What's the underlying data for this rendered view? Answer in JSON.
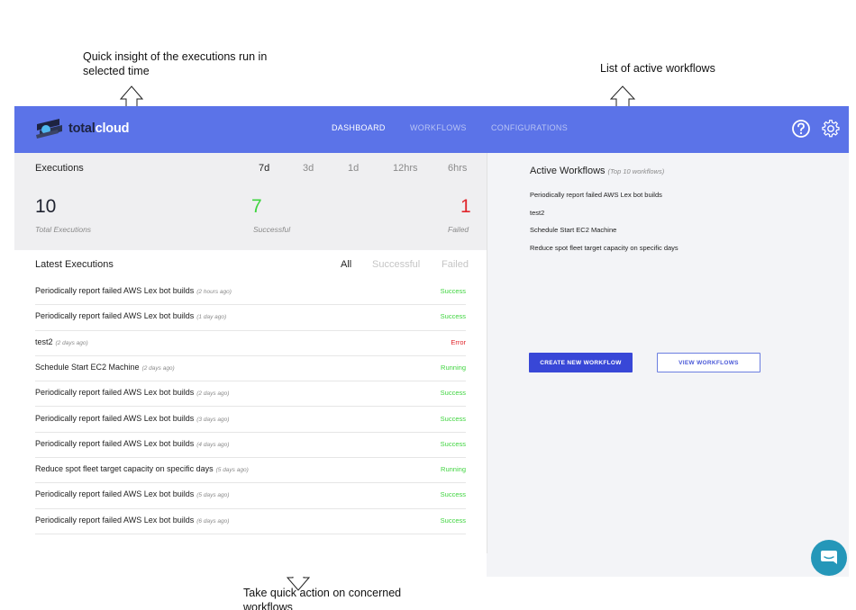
{
  "annotations": {
    "top_left": "Quick insight of the executions run in selected time",
    "top_right": "List of active workflows",
    "bottom": "Take quick action on concerned workflows"
  },
  "header": {
    "logo_part1": "total",
    "logo_part2": "cloud",
    "nav": [
      "DASHBOARD",
      "WORKFLOWS",
      "CONFIGURATIONS"
    ],
    "active_nav": "DASHBOARD",
    "icons": [
      "help-icon",
      "gear-icon"
    ]
  },
  "executions": {
    "title": "Executions",
    "ranges": [
      "7d",
      "3d",
      "1d",
      "12hrs",
      "6hrs"
    ],
    "selected_range": "7d",
    "total": {
      "value": "10",
      "label": "Total Executions"
    },
    "successful": {
      "value": "7",
      "label": "Successful"
    },
    "failed": {
      "value": "1",
      "label": "Failed"
    }
  },
  "latest": {
    "title": "Latest Executions",
    "filters": [
      "All",
      "Successful",
      "Failed"
    ],
    "selected_filter": "All",
    "rows": [
      {
        "name": "Periodically report failed AWS Lex bot builds",
        "ago": "(2 hours ago)",
        "status": "Success"
      },
      {
        "name": "Periodically report failed AWS Lex bot builds",
        "ago": "(1 day ago)",
        "status": "Success"
      },
      {
        "name": "test2",
        "ago": "(2 days ago)",
        "status": "Error"
      },
      {
        "name": "Schedule Start EC2 Machine",
        "ago": "(2 days ago)",
        "status": "Running"
      },
      {
        "name": "Periodically report failed AWS Lex bot builds",
        "ago": "(2 days ago)",
        "status": "Success"
      },
      {
        "name": "Periodically report failed AWS Lex bot builds",
        "ago": "(3 days ago)",
        "status": "Success"
      },
      {
        "name": "Periodically report failed AWS Lex bot builds",
        "ago": "(4 days ago)",
        "status": "Success"
      },
      {
        "name": "Reduce spot fleet target capacity on specific days",
        "ago": "(5 days ago)",
        "status": "Running"
      },
      {
        "name": "Periodically report failed AWS Lex bot builds",
        "ago": "(5 days ago)",
        "status": "Success"
      },
      {
        "name": "Periodically report failed AWS Lex bot builds",
        "ago": "(6 days ago)",
        "status": "Success"
      }
    ]
  },
  "active_workflows": {
    "title": "Active Workflows",
    "subtitle": "(Top 10 workflows)",
    "items": [
      "Periodically report failed AWS Lex bot builds",
      "test2",
      "Schedule Start EC2 Machine",
      "Reduce spot fleet target capacity on specific days"
    ],
    "create_button": "CREATE NEW WORKFLOW",
    "view_button": "VIEW WORKFLOWS"
  },
  "colors": {
    "header_bg": "#5b73e8",
    "success": "#3fd43f",
    "error": "#e0262c",
    "primary_button": "#3847d7",
    "chat": "#2597b9"
  }
}
